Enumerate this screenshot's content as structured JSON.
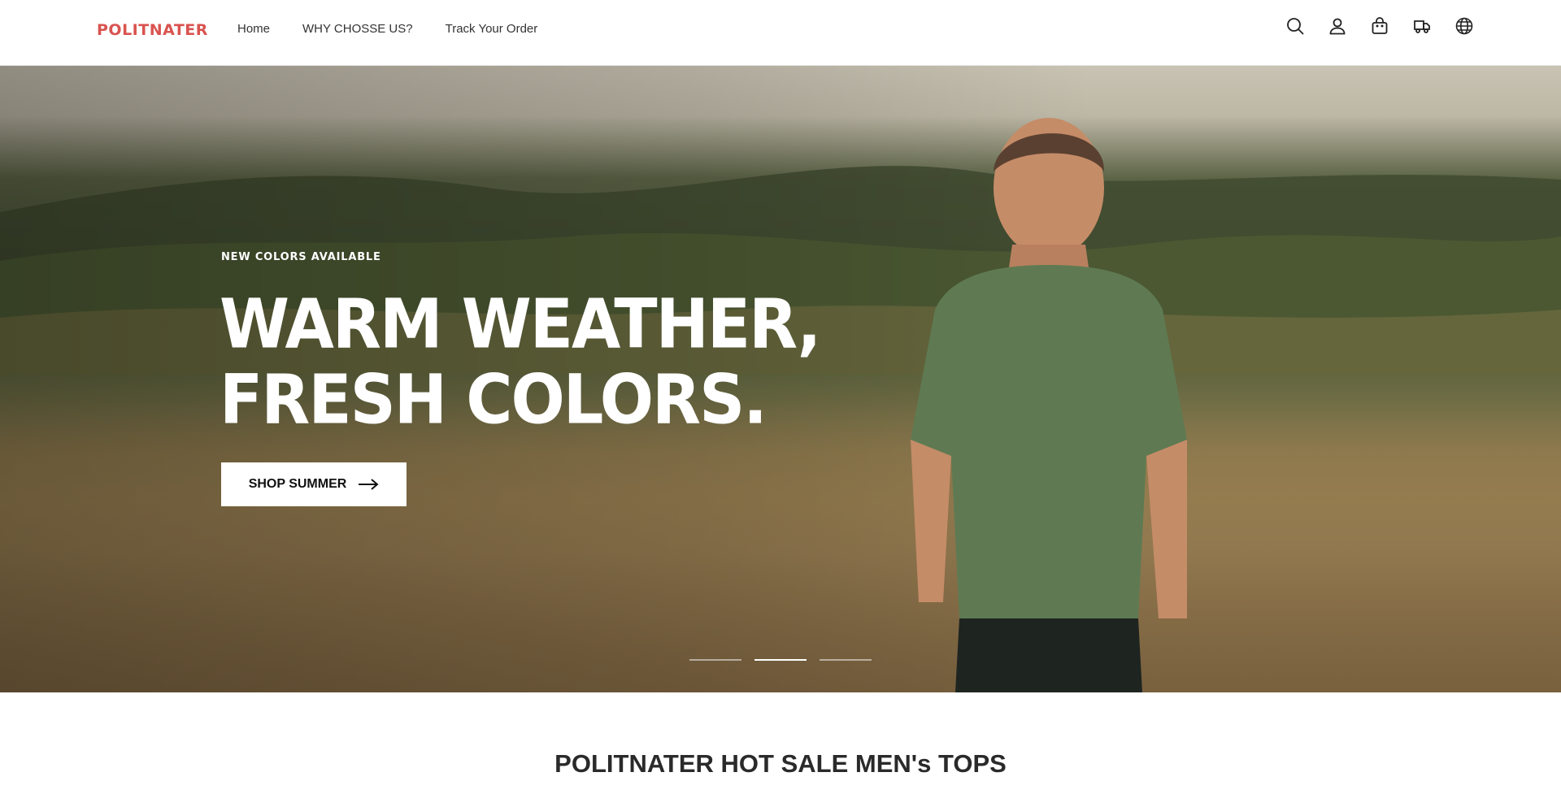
{
  "header": {
    "logo": "POLITNATER",
    "nav": [
      "Home",
      "WHY CHOSSE US?",
      "Track Your Order"
    ],
    "icons": [
      "search-icon",
      "account-icon",
      "cart-icon",
      "truck-icon",
      "globe-icon"
    ]
  },
  "hero": {
    "eyebrow": "NEW COLORS AVAILABLE",
    "headline_line1": "WARM WEATHER,",
    "headline_line2": "FRESH COLORS.",
    "cta_label": "SHOP SUMMER",
    "slides_total": 3,
    "active_slide": 2
  },
  "section": {
    "title": "POLITNATER HOT SALE MEN's TOPS"
  },
  "colors": {
    "brand": "#d9534f",
    "text": "#333333",
    "cta_bg": "#ffffff"
  }
}
